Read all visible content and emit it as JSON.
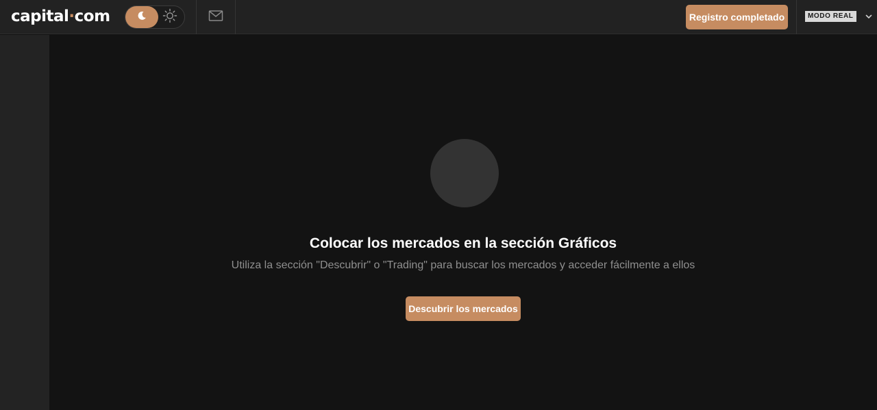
{
  "header": {
    "logo": {
      "part1": "capital",
      "dot": "·",
      "part2": "com"
    },
    "theme_toggle": {
      "active": "dark",
      "icons": [
        "moon-icon",
        "sun-icon"
      ]
    },
    "mail_icon": "mail-icon",
    "register_button": "Registro completado",
    "mode_badge": "MODO REAL",
    "mode_chevron_icon": "chevron-down-icon"
  },
  "empty_state": {
    "title": "Colocar los mercados en la sección Gráficos",
    "subtitle": "Utiliza la sección \"Descubrir\" o \"Trading\" para buscar los mercados y acceder fácilmente a ellos",
    "button": "Descubrir los mercados"
  },
  "colors": {
    "accent": "#c68c61",
    "background": "#131313",
    "topbar": "#222222",
    "sidebar": "#232323",
    "placeholder_circle": "#333333",
    "muted_text": "#8f8f8f"
  }
}
